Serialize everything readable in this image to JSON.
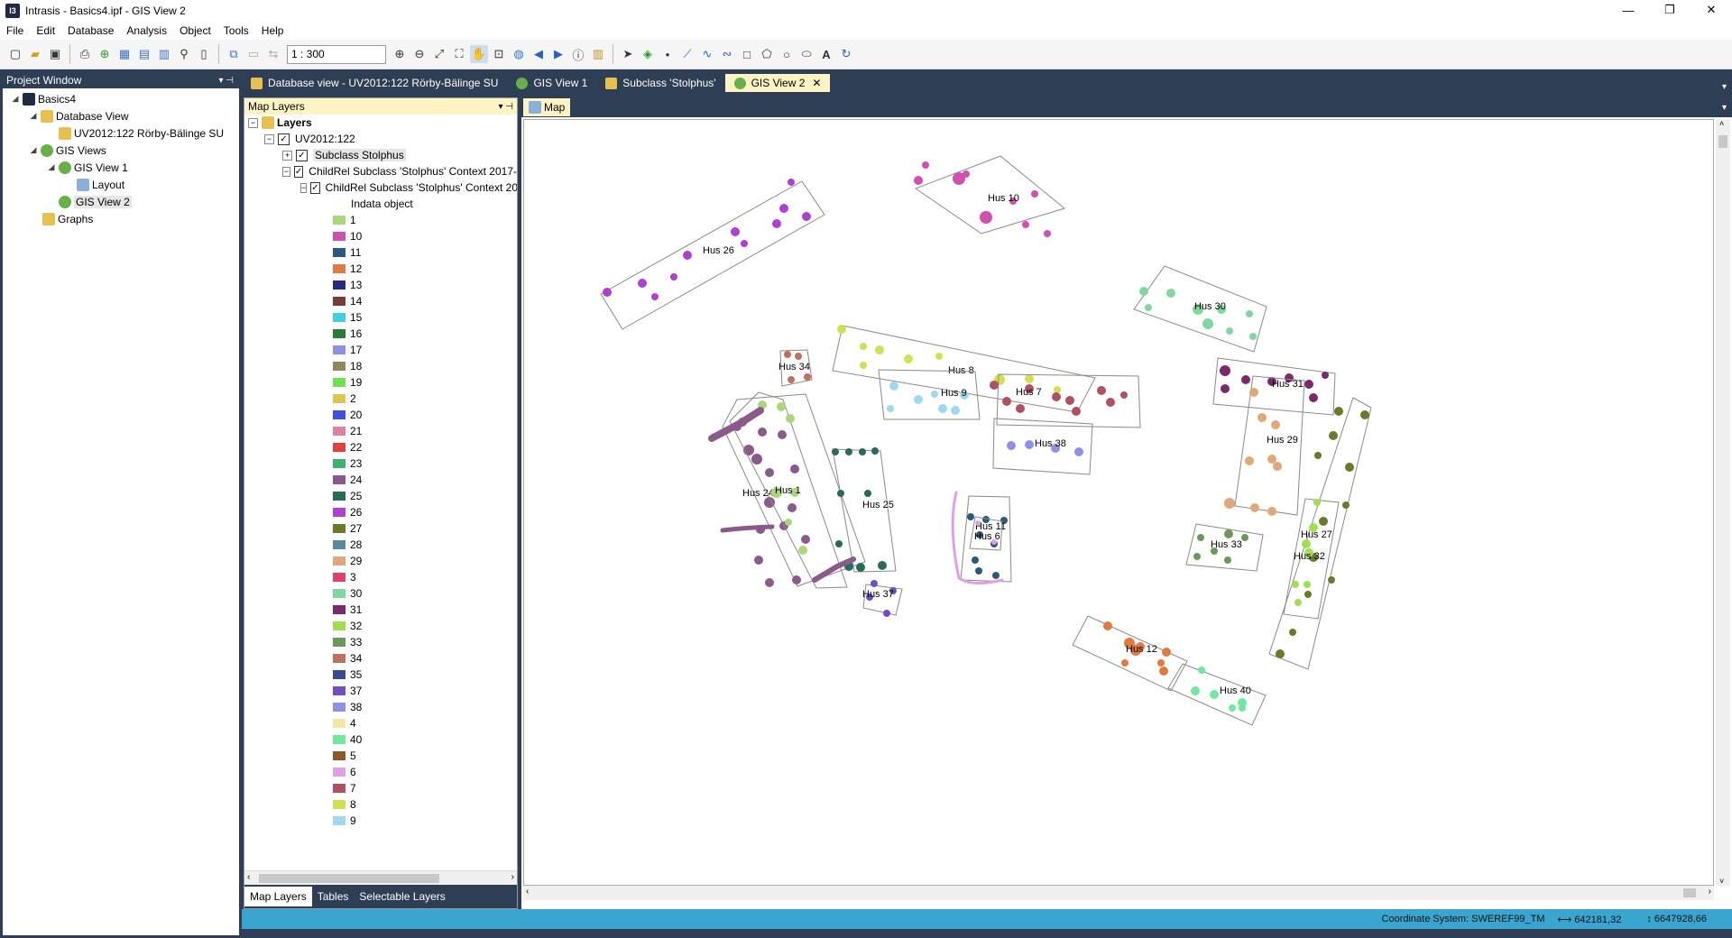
{
  "window": {
    "title": "Intrasis - Basics4.ipf - GIS View 2",
    "app_icon": "I3"
  },
  "menu": [
    "File",
    "Edit",
    "Database",
    "Analysis",
    "Object",
    "Tools",
    "Help"
  ],
  "toolbar": {
    "scale_value": "1 : 300"
  },
  "project_window": {
    "title": "Project Window",
    "tree": [
      {
        "label": "Basics4",
        "level": 0
      },
      {
        "label": "Database View",
        "level": 1
      },
      {
        "label": "UV2012:122 Rörby-Bälinge SU",
        "level": 2
      },
      {
        "label": "GIS Views",
        "level": 1
      },
      {
        "label": "GIS View 1",
        "level": 2
      },
      {
        "label": "Layout",
        "level": 3
      },
      {
        "label": "GIS View 2",
        "level": 2
      },
      {
        "label": "Graphs",
        "level": 1
      }
    ]
  },
  "tabs": [
    {
      "label": "Database view - UV2012:122 Rörby-Bälinge SU",
      "active": false
    },
    {
      "label": "GIS View 1",
      "active": false
    },
    {
      "label": "Subclass 'Stolphus'",
      "active": false
    },
    {
      "label": "GIS View 2",
      "active": true
    }
  ],
  "map_layers": {
    "title": "Map Layers",
    "root": "Layers",
    "group": "UV2012:122",
    "layer1": "Subclass Stolphus",
    "layer2": "ChildRel Subclass 'Stolphus' Context 2017-",
    "layer3": "ChildRel Subclass 'Stolphus' Context 20",
    "legend_title": "Indata object",
    "legend": [
      {
        "label": "1",
        "color": "#a8d878"
      },
      {
        "label": "10",
        "color": "#d050b0"
      },
      {
        "label": "11",
        "color": "#2a5a7a"
      },
      {
        "label": "12",
        "color": "#e07a40"
      },
      {
        "label": "13",
        "color": "#2a2a7a"
      },
      {
        "label": "14",
        "color": "#7a3a3a"
      },
      {
        "label": "15",
        "color": "#40d0e0"
      },
      {
        "label": "16",
        "color": "#2a7a3a"
      },
      {
        "label": "17",
        "color": "#9090e0"
      },
      {
        "label": "18",
        "color": "#8a8a5a"
      },
      {
        "label": "19",
        "color": "#70e050"
      },
      {
        "label": "2",
        "color": "#d8c850"
      },
      {
        "label": "20",
        "color": "#4050e0"
      },
      {
        "label": "21",
        "color": "#e080a0"
      },
      {
        "label": "22",
        "color": "#e04040"
      },
      {
        "label": "23",
        "color": "#40b070"
      },
      {
        "label": "24",
        "color": "#8a5a8a"
      },
      {
        "label": "25",
        "color": "#2a6a5a"
      },
      {
        "label": "26",
        "color": "#b040d0"
      },
      {
        "label": "27",
        "color": "#6a7a2a"
      },
      {
        "label": "28",
        "color": "#5a8a9a"
      },
      {
        "label": "29",
        "color": "#e0a878"
      },
      {
        "label": "3",
        "color": "#e04070"
      },
      {
        "label": "30",
        "color": "#80d8a0"
      },
      {
        "label": "31",
        "color": "#7a2a6a"
      },
      {
        "label": "32",
        "color": "#a0e050"
      },
      {
        "label": "33",
        "color": "#6a9a5a"
      },
      {
        "label": "34",
        "color": "#c07060"
      },
      {
        "label": "35",
        "color": "#3a4a8a"
      },
      {
        "label": "37",
        "color": "#7050c0"
      },
      {
        "label": "38",
        "color": "#9090e8"
      },
      {
        "label": "4",
        "color": "#f0e8a0"
      },
      {
        "label": "40",
        "color": "#70e8a0"
      },
      {
        "label": "5",
        "color": "#8a5a2a"
      },
      {
        "label": "6",
        "color": "#e0a0e8"
      },
      {
        "label": "7",
        "color": "#b05060"
      },
      {
        "label": "8",
        "color": "#d0e050"
      },
      {
        "label": "9",
        "color": "#a0d8f0"
      }
    ],
    "bottom_tabs": [
      "Map Layers",
      "Tables",
      "Selectable Layers"
    ]
  },
  "map": {
    "tab_label": "Map",
    "houses": [
      {
        "label": "Hus 10",
        "color": "#d050b0"
      },
      {
        "label": "Hus 26",
        "color": "#b040d0"
      },
      {
        "label": "Hus 30",
        "color": "#80d8a0"
      },
      {
        "label": "Hus 34",
        "color": "#c07060"
      },
      {
        "label": "Hus 8",
        "color": "#d0e050"
      },
      {
        "label": "Hus 9",
        "color": "#a0d8f0"
      },
      {
        "label": "Hus 7",
        "color": "#b05060"
      },
      {
        "label": "Hus 31",
        "color": "#7a2a6a"
      },
      {
        "label": "Hus 38",
        "color": "#9090e8"
      },
      {
        "label": "Hus 29",
        "color": "#e0a878"
      },
      {
        "label": "Hus 24",
        "color": "#8a5a8a"
      },
      {
        "label": "Hus 1",
        "color": "#a8d878"
      },
      {
        "label": "Hus 25",
        "color": "#2a6a5a"
      },
      {
        "label": "Hus 11",
        "color": "#2a5a7a"
      },
      {
        "label": "Hus 6",
        "color": "#e0a0e8"
      },
      {
        "label": "Hus 27",
        "color": "#6a7a2a"
      },
      {
        "label": "Hus 33",
        "color": "#6a9a5a"
      },
      {
        "label": "Hus 32",
        "color": "#a0e050"
      },
      {
        "label": "Hus 37",
        "color": "#7050c0"
      },
      {
        "label": "Hus 12",
        "color": "#e07a40"
      },
      {
        "label": "Hus 40",
        "color": "#70e8a0"
      }
    ]
  },
  "status": {
    "coordinate_system": "Coordinate System: SWEREF99_TM",
    "x": "642181,32",
    "y": "6647928,66"
  }
}
